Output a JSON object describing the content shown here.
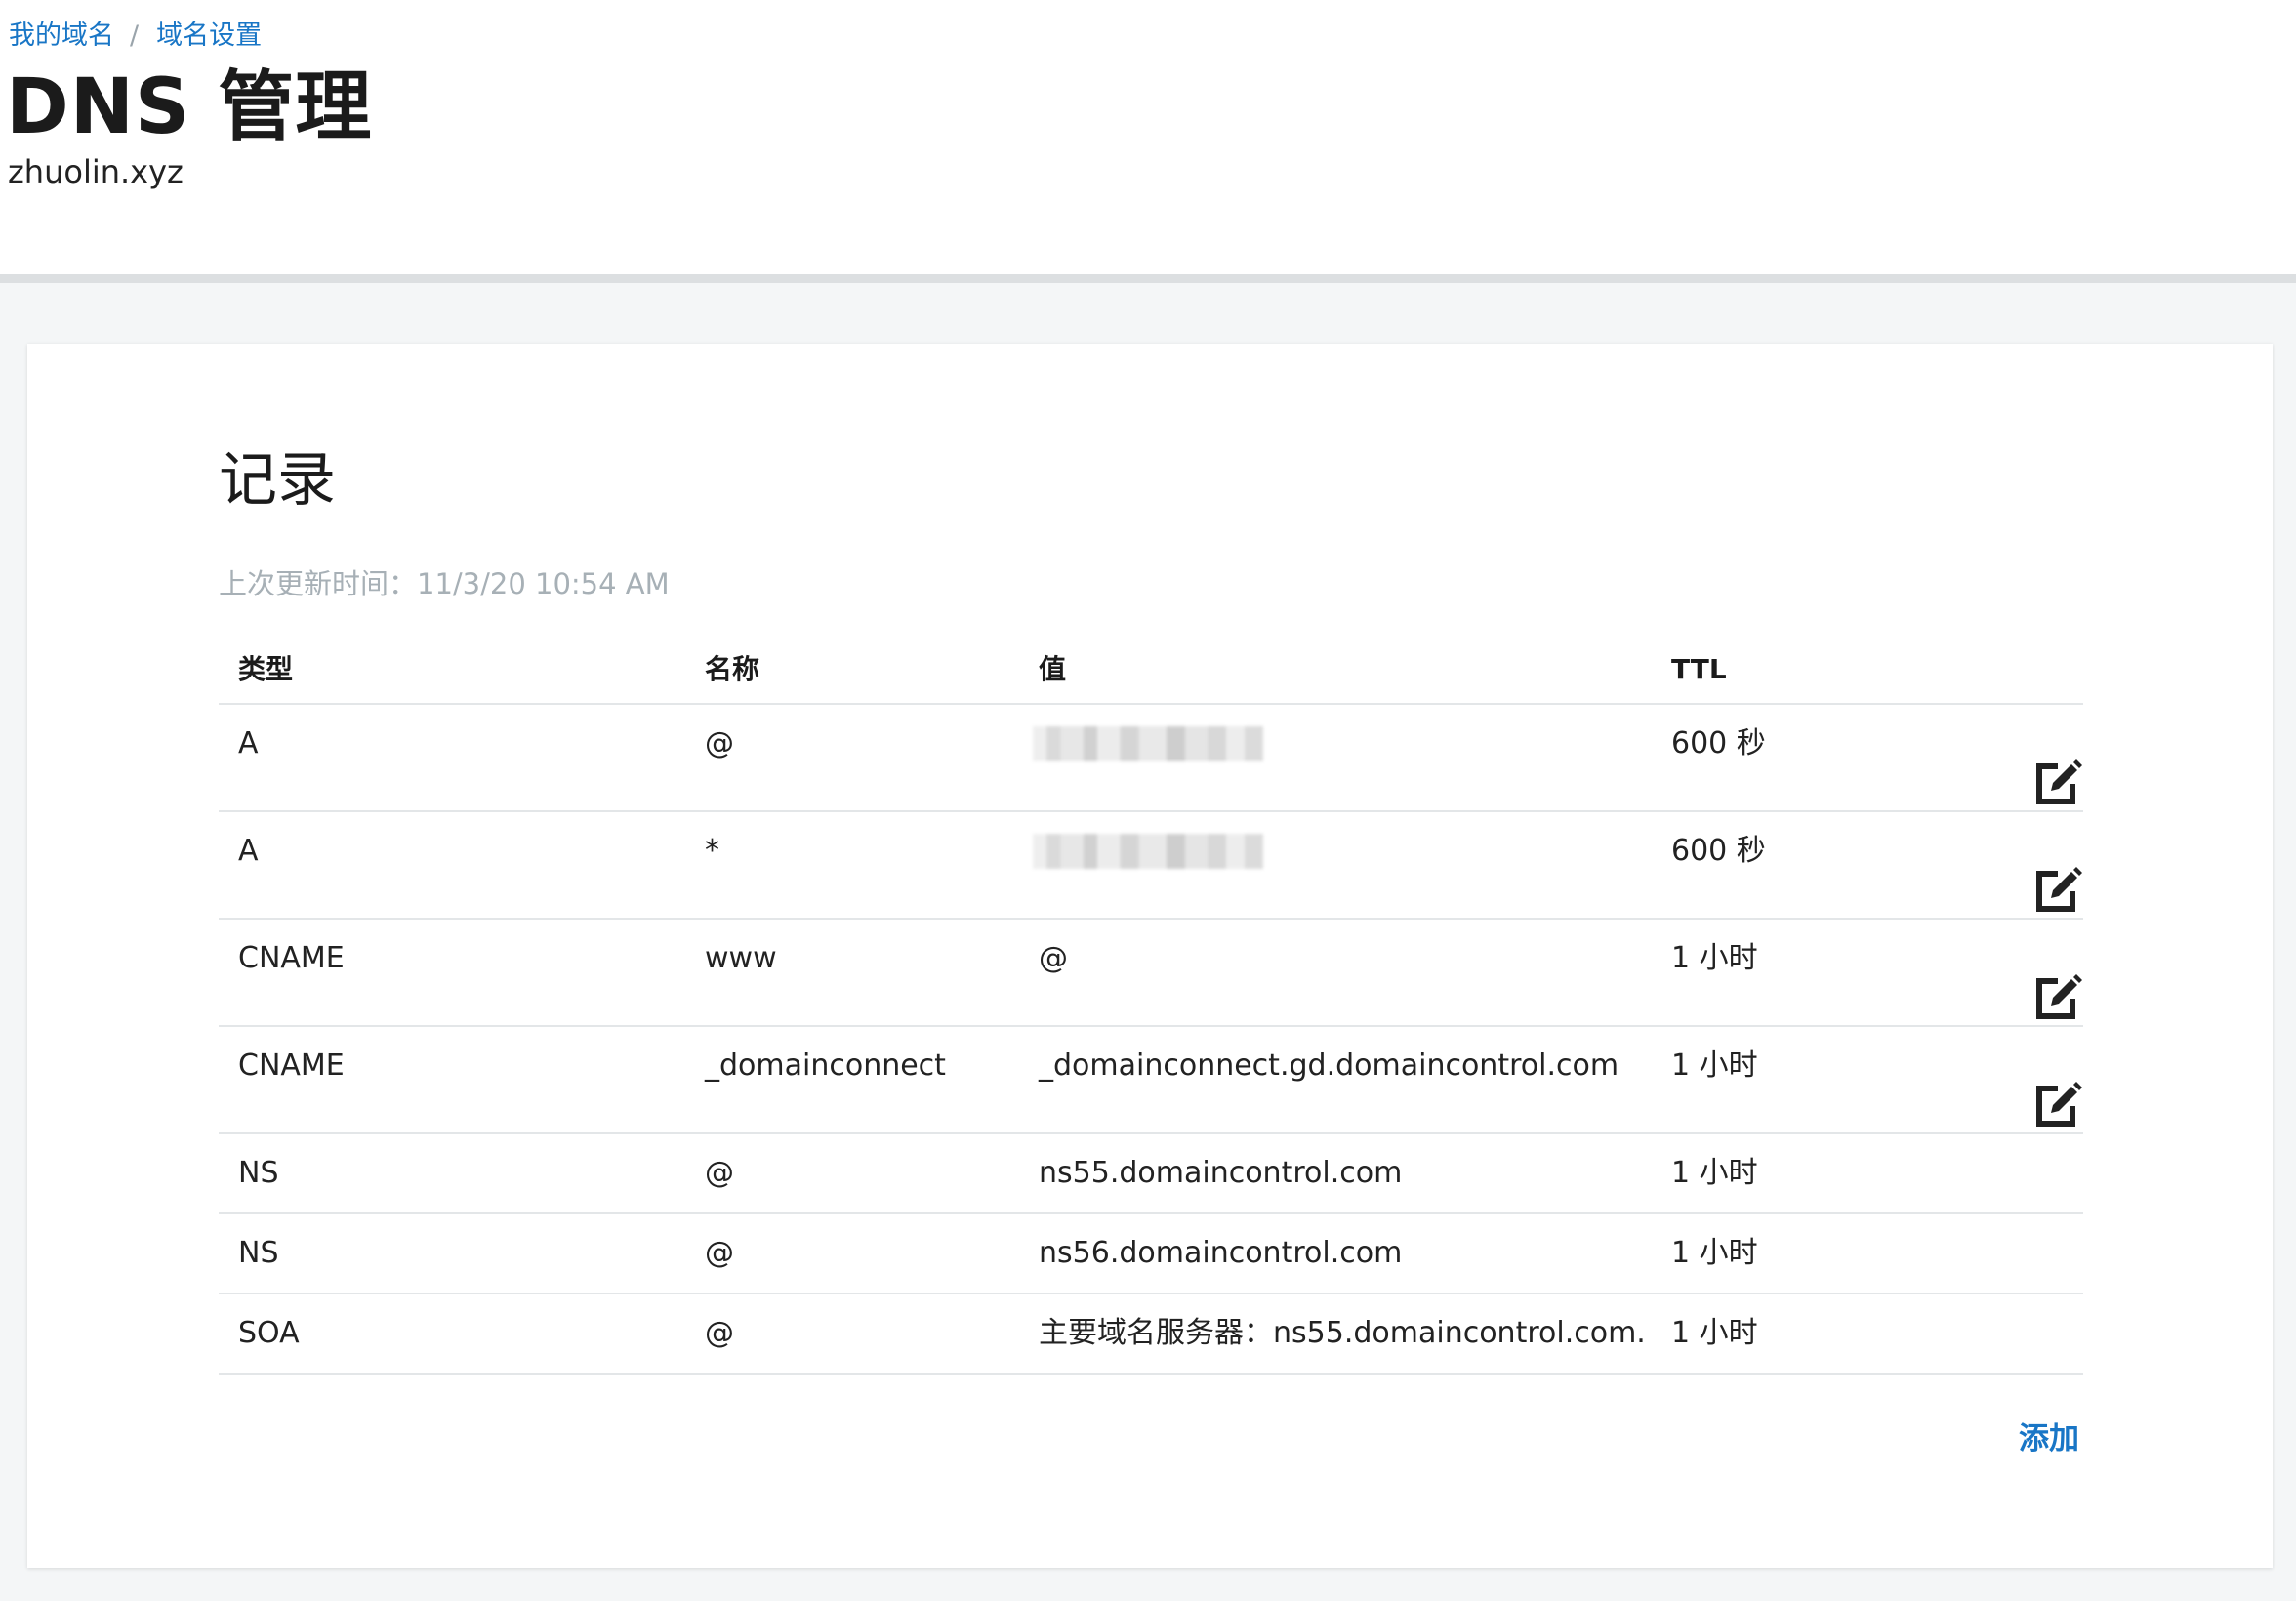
{
  "breadcrumb": {
    "items": [
      "我的域名",
      "域名设置"
    ],
    "separator": "/"
  },
  "header": {
    "title": "DNS 管理",
    "domain": "zhuolin.xyz"
  },
  "records": {
    "title": "记录",
    "last_updated": "上次更新时间：11/3/20 10:54 AM",
    "columns": {
      "type": "类型",
      "name": "名称",
      "value": "值",
      "ttl": "TTL"
    },
    "rows": [
      {
        "type": "A",
        "name": "@",
        "value": "",
        "ttl": "600 秒",
        "editable": true,
        "value_hidden": true
      },
      {
        "type": "A",
        "name": "*",
        "value": "",
        "ttl": "600 秒",
        "editable": true,
        "value_hidden": true
      },
      {
        "type": "CNAME",
        "name": "www",
        "value": "@",
        "ttl": "1 小时",
        "editable": true
      },
      {
        "type": "CNAME",
        "name": "_domainconnect",
        "value": "_domainconnect.gd.domaincontrol.com",
        "ttl": "1 小时",
        "editable": true
      },
      {
        "type": "NS",
        "name": "@",
        "value": "ns55.domaincontrol.com",
        "ttl": "1 小时",
        "editable": false
      },
      {
        "type": "NS",
        "name": "@",
        "value": "ns56.domaincontrol.com",
        "ttl": "1 小时",
        "editable": false
      },
      {
        "type": "SOA",
        "name": "@",
        "value": "主要域名服务器：ns55.domaincontrol.com.",
        "ttl": "1 小时",
        "editable": false
      }
    ],
    "add_label": "添加"
  },
  "colors": {
    "link": "#1976c6",
    "muted": "#a7b0b6",
    "page_bg": "#f4f6f7",
    "divider": "#e3e6e8"
  },
  "icons": {
    "edit": "edit-icon"
  }
}
